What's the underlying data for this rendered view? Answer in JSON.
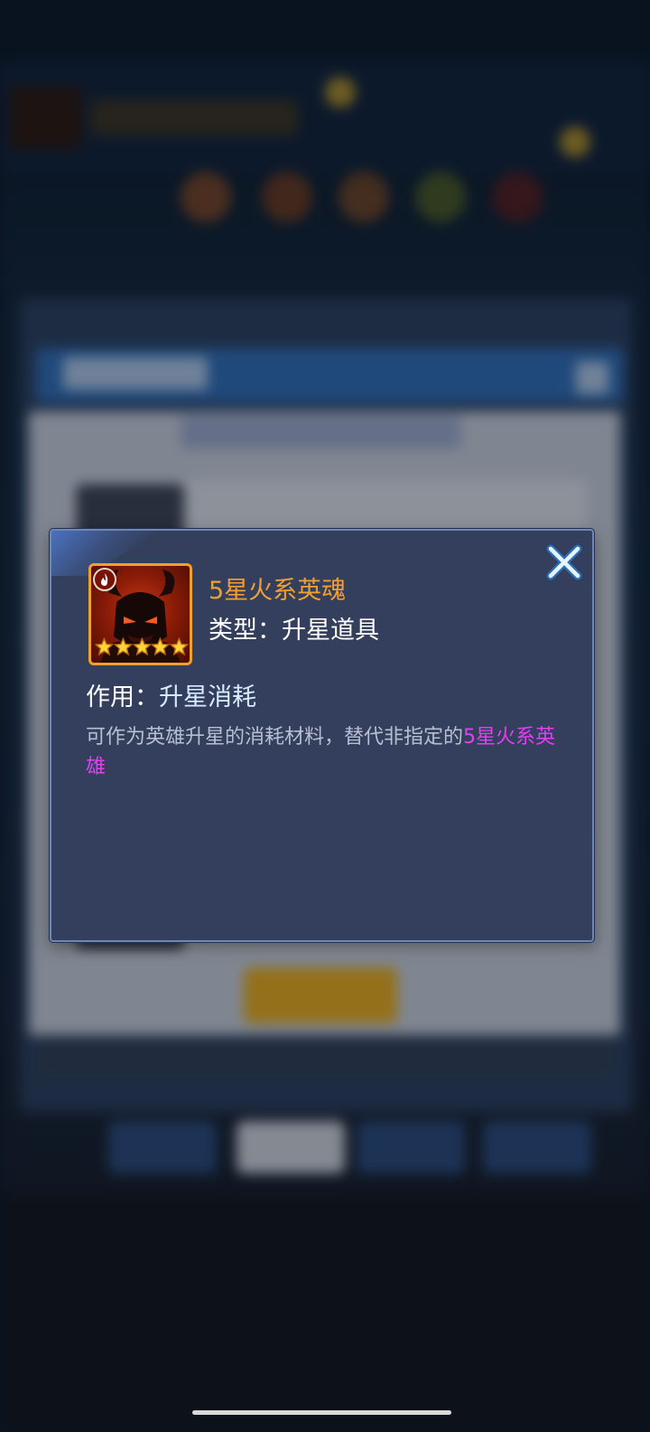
{
  "item": {
    "name": "5星火系英魂",
    "type_label": "类型：",
    "type_value": "升星道具",
    "use_label": "作用：",
    "use_value": "升星消耗",
    "description_plain": "可作为英雄升星的消耗材料，替代非指定的",
    "description_highlight": "5星火系英雄",
    "star_count": 5,
    "element_icon": "fire-element-icon",
    "portrait_icon": "horned-demon-helmet-icon"
  },
  "dialog": {
    "close_icon": "close-icon"
  },
  "colors": {
    "item_name": "#f0a030",
    "highlight": "#e040f0",
    "dialog_bg": "#343f5e",
    "dialog_border": "#6f86b8"
  }
}
